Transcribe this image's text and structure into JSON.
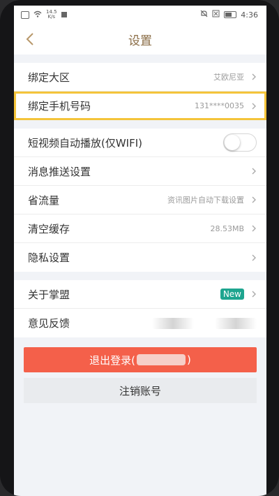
{
  "status_bar": {
    "speed_top": "14.5",
    "speed_unit": "K/s",
    "time": "4:36"
  },
  "header": {
    "title": "设置"
  },
  "account_group": {
    "items": [
      {
        "label": "绑定大区",
        "value": "艾欧尼亚"
      },
      {
        "label": "绑定手机号码",
        "value": "131****0035"
      }
    ]
  },
  "settings_group": {
    "items": [
      {
        "label": "短视频自动播放(仅WIFI)",
        "toggle_on": false
      },
      {
        "label": "消息推送设置"
      },
      {
        "label": "省流量",
        "value": "资讯图片自动下载设置"
      },
      {
        "label": "清空缓存",
        "value": "28.53MB"
      },
      {
        "label": "隐私设置"
      }
    ]
  },
  "about_group": {
    "items": [
      {
        "label": "关于掌盟",
        "badge": "New"
      },
      {
        "label": "意见反馈"
      }
    ]
  },
  "buttons": {
    "logout_prefix": "退出登录(",
    "logout_suffix": ")",
    "cancel_account": "注销账号"
  },
  "colors": {
    "accent": "#8a6c45",
    "highlight": "#f4c43a",
    "logout": "#f4604a",
    "badge": "#1ea58f"
  }
}
